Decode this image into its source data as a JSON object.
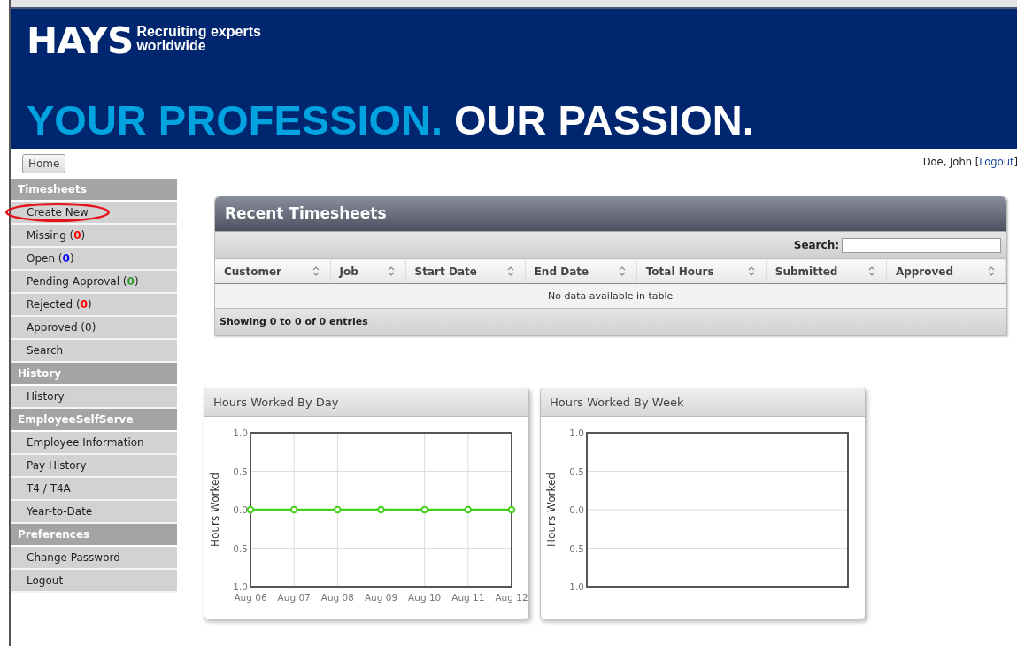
{
  "banner": {
    "logo": "HAYS",
    "tagline": [
      "Recruiting experts",
      "worldwide"
    ],
    "slogan_part1": "YOUR PROFESSION.",
    "slogan_part2": "OUR PASSION."
  },
  "home_button": "Home",
  "user": {
    "text_before": "Doe, John [",
    "link": "Logout",
    "text_after": "]"
  },
  "sidebar": {
    "sections": [
      {
        "title": "Timesheets",
        "items": [
          {
            "label": "Create New",
            "circled": true
          },
          {
            "label": "Missing",
            "count": "(0)",
            "color": "#ff0000"
          },
          {
            "label": "Open",
            "count": "(0)",
            "color": "#0000ff"
          },
          {
            "label": "Pending Approval",
            "count": "(0)",
            "color": "#339933"
          },
          {
            "label": "Rejected",
            "count": "(0)",
            "color": "#ff0000"
          },
          {
            "label": "Approved",
            "count": "(0)"
          },
          {
            "label": "Search"
          }
        ]
      },
      {
        "title": "History",
        "items": [
          {
            "label": "History"
          }
        ]
      },
      {
        "title": "EmployeeSelfServe",
        "items": [
          {
            "label": "Employee Information"
          },
          {
            "label": "Pay History"
          },
          {
            "label": "T4 / T4A"
          },
          {
            "label": "Year-to-Date"
          }
        ]
      },
      {
        "title": "Preferences",
        "items": [
          {
            "label": "Change Password"
          },
          {
            "label": "Logout"
          }
        ]
      }
    ]
  },
  "recent_timesheets": {
    "title": "Recent Timesheets",
    "search_label": "Search:",
    "columns": [
      "Customer",
      "Job",
      "Start Date",
      "End Date",
      "Total Hours",
      "Submitted",
      "Approved"
    ],
    "empty_message": "No data available in table",
    "footer": "Showing 0 to 0 of 0 entries"
  },
  "charts": [
    {
      "chart_data": {
        "type": "line",
        "title": "Hours Worked By Day",
        "ylabel": "Hours Worked",
        "categories": [
          "Aug 06",
          "Aug 07",
          "Aug 08",
          "Aug 09",
          "Aug 10",
          "Aug 11",
          "Aug 12"
        ],
        "grid": true,
        "series": [
          {
            "color": "#44d01a",
            "marker": true,
            "values": [
              0,
              0,
              0,
              0,
              0,
              0,
              0
            ]
          }
        ],
        "ylim": [
          -1,
          1
        ],
        "yticks": [
          {
            "value": 1,
            "label": "1.0"
          },
          {
            "value": 0.5,
            "label": "0.5"
          },
          {
            "value": 0,
            "label": "0.0"
          },
          {
            "value": -0.5,
            "label": "-0.5"
          },
          {
            "value": -1,
            "label": "-1.0"
          }
        ]
      }
    },
    {
      "empty_chart": {
        "title": "Hours Worked By Week",
        "ylabel": "Hours Worked",
        "axis_labels": [
          "1.0",
          "0.5",
          "0.0",
          "-0.5",
          "-1.0"
        ]
      }
    }
  ]
}
